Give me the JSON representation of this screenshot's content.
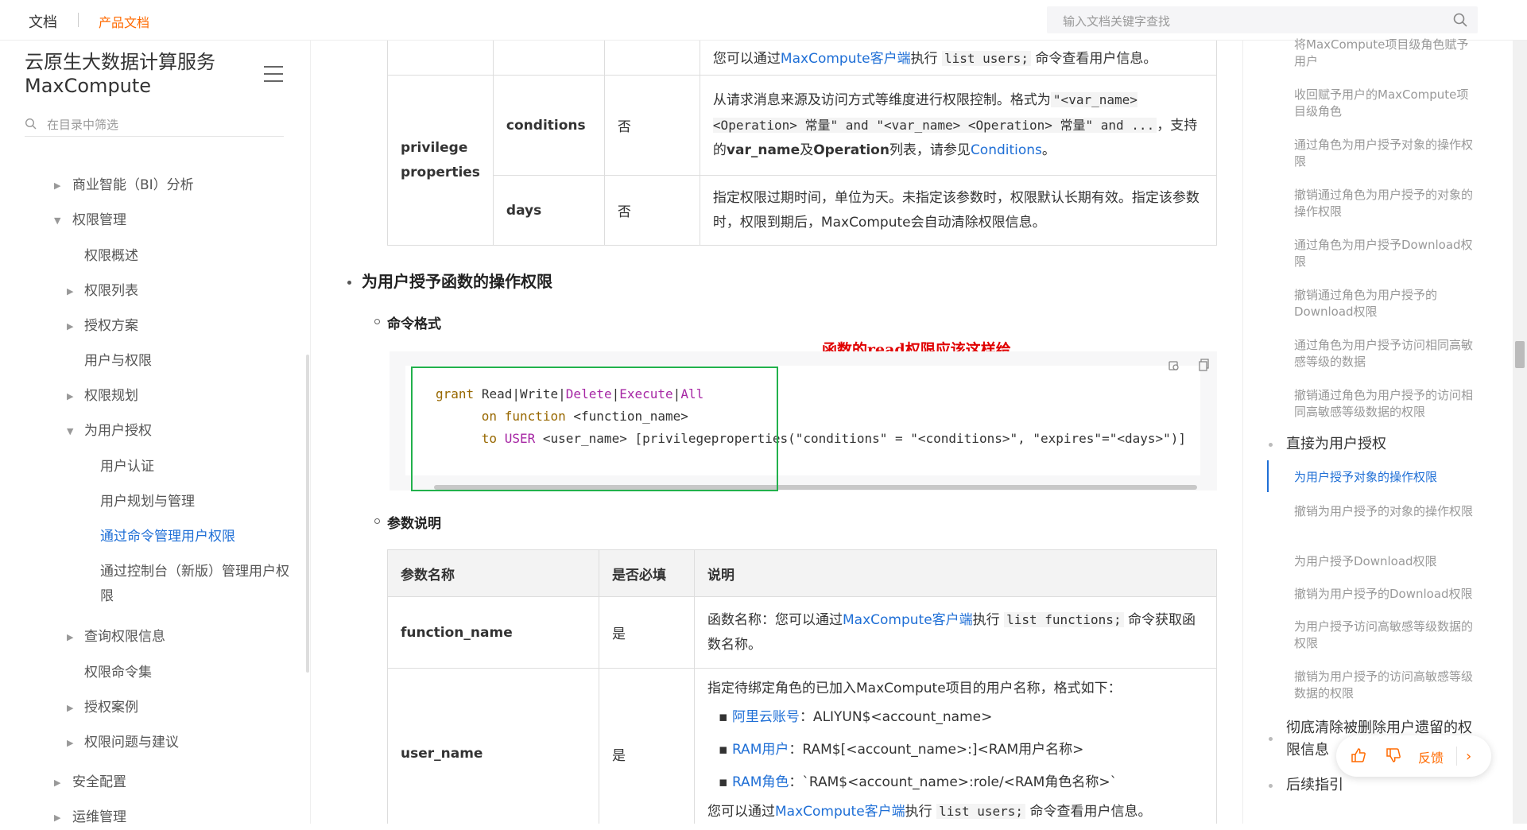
{
  "topbar": {
    "brand": "文档",
    "product": "产品文档",
    "search_placeholder": "输入文档关键字查找"
  },
  "sidebar": {
    "title": "云原生大数据计算服务 MaxCompute",
    "filter_placeholder": "在目录中筛选",
    "items": [
      {
        "label": "商业智能（BI）分析",
        "arrow": "▶"
      },
      {
        "label": "权限管理",
        "arrow": "▼"
      },
      {
        "label": "权限概述",
        "arrow": ""
      },
      {
        "label": "权限列表",
        "arrow": "▶"
      },
      {
        "label": "授权方案",
        "arrow": "▶"
      },
      {
        "label": "用户与权限",
        "arrow": ""
      },
      {
        "label": "权限规划",
        "arrow": "▶"
      },
      {
        "label": "为用户授权",
        "arrow": "▼"
      },
      {
        "label": "用户认证",
        "arrow": ""
      },
      {
        "label": "用户规划与管理",
        "arrow": ""
      },
      {
        "label": "通过命令管理用户权限",
        "arrow": ""
      },
      {
        "label": "通过控制台（新版）管理用户权限",
        "arrow": ""
      },
      {
        "label": "查询权限信息",
        "arrow": "▶"
      },
      {
        "label": "权限命令集",
        "arrow": ""
      },
      {
        "label": "授权案例",
        "arrow": "▶"
      },
      {
        "label": "权限问题与建议",
        "arrow": "▶"
      },
      {
        "label": "安全配置",
        "arrow": "▶"
      },
      {
        "label": "运维管理",
        "arrow": "▶"
      }
    ]
  },
  "top_table": {
    "row0_text_a": "您可以通过",
    "row0_link": "MaxCompute客户端",
    "row0_text_b": "执行",
    "row0_code": "list users;",
    "row0_text_c": "命令查看用户信息。",
    "group_label": "privilege properties",
    "conditions": {
      "name": "conditions",
      "required": "否",
      "desc_a": "从请求消息来源及访问方式等维度进行权限控制。格式为",
      "desc_code1": "\"<var_name> <Operation> 常量\" and \"<var_name> <Operation> 常量\" and ...",
      "desc_b": "，支持的",
      "desc_bold1": "var_name",
      "desc_c": "及",
      "desc_bold2": "Operation",
      "desc_d": "列表，请参见",
      "desc_link": "Conditions",
      "desc_e": "。"
    },
    "days": {
      "name": "days",
      "required": "否",
      "desc": "指定权限过期时间，单位为天。未指定该参数时，权限默认长期有效。指定该参数时，权限到期后，MaxCompute会自动清除权限信息。"
    }
  },
  "section": {
    "title": "为用户授予函数的操作权限",
    "cmd_heading": "命令格式",
    "annotation": "函数的read权限应该这样给",
    "code": {
      "l1_kw": "grant",
      "l1_r": "Read",
      "l1_w": "Write",
      "l1_d": "Delete",
      "l1_e": "Execute",
      "l1_a": "All",
      "l2_on": "on",
      "l2_fn": "function",
      "l2_rest": " <function_name>",
      "l3_to": "to",
      "l3_user": "USER",
      "l3_rest": " <user_name> [privilegeproperties(\"conditions\" = \"<conditions>\", \"expires\"=\"<days>\")]"
    },
    "param_heading": "参数说明"
  },
  "param_table": {
    "headers": [
      "参数名称",
      "是否必填",
      "说明"
    ],
    "function_name": {
      "name": "function_name",
      "required": "是",
      "desc_a": "函数名称：您可以通过",
      "desc_link": "MaxCompute客户端",
      "desc_b": "执行",
      "desc_code": "list functions;",
      "desc_c": "命令获取函数名称。"
    },
    "user_name": {
      "name": "user_name",
      "required": "是",
      "desc_intro": "指定待绑定角色的已加入MaxCompute项目的用户名称，格式如下：",
      "b1_link": "阿里云账号",
      "b1_text": "：ALIYUN$<account_name>",
      "b2_link": "RAM用户",
      "b2_text": "：RAM$[<account_name>:]<RAM用户名称>",
      "b3_link": "RAM角色",
      "b3_text": "：`RAM$<account_name>:role/<RAM角色名称>`",
      "tail_a": "您可以通过",
      "tail_link": "MaxCompute客户端",
      "tail_b": "执行",
      "tail_code": "list users;",
      "tail_c": "命令查看用户信息。"
    }
  },
  "toc": {
    "items_top": [
      "将MaxCompute项目级角色赋予用户",
      "收回赋予用户的MaxCompute项目级角色",
      "通过角色为用户授予对象的操作权限",
      "撤销通过角色为用户授予的对象的操作权限",
      "通过角色为用户授予Download权限",
      "撤销通过角色为用户授予的Download权限",
      "通过角色为用户授予访问相同高敏感等级的数据",
      "撤销通过角色为用户授予的访问相同高敏感等级数据的权限"
    ],
    "heading_direct": "直接为用户授权",
    "items_direct": [
      "为用户授予对象的操作权限",
      "撤销为用户授予的对象的操作权限",
      "为用户授予Download权限",
      "撤销为用户授予的Download权限",
      "为用户授予访问高敏感等级数据的权限",
      "撤销为用户授予的访问高敏感等级数据的权限"
    ],
    "heading_purge": "彻底清除被删除用户遗留的权限信息",
    "heading_next": "后续指引"
  },
  "feedback": {
    "label": "反馈"
  },
  "colors": {
    "accent": "#ff6a00",
    "link": "#1f6fd6",
    "annotation": "#e00000",
    "highlight_box": "#22b14c"
  }
}
